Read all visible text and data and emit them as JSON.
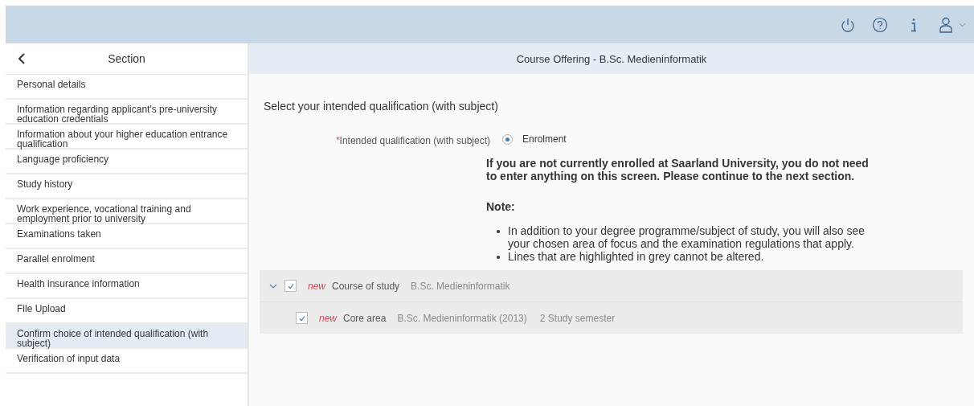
{
  "sidebar": {
    "title": "Section",
    "items": [
      {
        "label": "Personal details",
        "selected": false
      },
      {
        "label": "Information regarding applicant's pre-university education credentials",
        "selected": false
      },
      {
        "label": "Information about your higher education entrance qualification",
        "selected": false
      },
      {
        "label": "Language proficiency",
        "selected": false
      },
      {
        "label": "Study history",
        "selected": false
      },
      {
        "label": "Work experience, vocational training and employment prior to university",
        "selected": false
      },
      {
        "label": "Examinations taken",
        "selected": false
      },
      {
        "label": "Parallel enrolment",
        "selected": false
      },
      {
        "label": "Health insurance information",
        "selected": false
      },
      {
        "label": "File Upload",
        "selected": false
      },
      {
        "label": "Confirm choice of intended qualification (with subject)",
        "selected": true
      },
      {
        "label": "Verification of input data",
        "selected": false
      }
    ]
  },
  "main": {
    "title": "Course Offering - B.Sc. Medieninformatik",
    "heading": "Select your intended qualification (with subject)",
    "field": {
      "required_mark": "*",
      "label": "Intended qualification (with subject)",
      "options": [
        {
          "label": "Enrolment",
          "selected": true
        }
      ]
    },
    "notice": "If you are not currently enrolled at Saarland University, you do not need to enter anything on this screen. Please continue to the next section.",
    "note_title": "Note:",
    "notes": [
      "In addition to your degree programme/subject of study, you will also see your chosen area of focus and the examination regulations that apply.",
      "Lines that are highlighted in grey cannot be altered."
    ],
    "tree": [
      {
        "expanded": true,
        "checked": true,
        "badge": "new",
        "label": "Course of study",
        "values": [
          "B.Sc. Medieninformatik"
        ],
        "children": [
          {
            "checked": true,
            "badge": "new",
            "label": "Core area",
            "values": [
              "B.Sc. Medieninformatik (2013)",
              "2 Study semester"
            ]
          }
        ]
      }
    ]
  }
}
